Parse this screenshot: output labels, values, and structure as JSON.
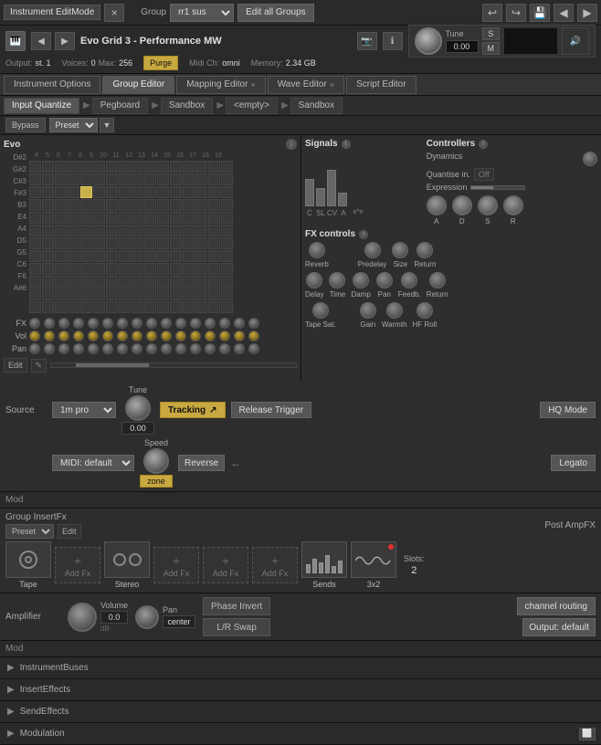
{
  "app": {
    "title": "Instrument EditMode",
    "close_label": "×"
  },
  "top_bar": {
    "mode_label": "Group",
    "group_select": "rr1 sus",
    "edit_btn": "Edit all Groups",
    "undo_icon": "↩",
    "redo_icon": "↪",
    "save_icon": "💾",
    "arrow_left": "◀",
    "arrow_right": "▶"
  },
  "instrument": {
    "name": "Evo Grid 3 - Performance MW",
    "output_label": "Output:",
    "output_val": "st. 1",
    "voices_label": "Voices:",
    "voices_val": "0",
    "max_label": "Max:",
    "max_val": "256",
    "purge_btn": "Purge",
    "midi_label": "Midi Ch:",
    "midi_val": "omni",
    "memory_label": "Memory:",
    "memory_val": "2.34 GB"
  },
  "tabs": {
    "instrument_options": "Instrument Options",
    "group_editor": "Group Editor",
    "mapping_editor": "Mapping Editor",
    "wave_editor": "Wave Editor",
    "script_editor": "Script Editor"
  },
  "sub_tabs": {
    "input_quantize": "Input Quantize",
    "pegboard": "Pegboard",
    "sandbox1": "Sandbox",
    "empty": "<empty>",
    "sandbox2": "Sandbox"
  },
  "evo": {
    "title": "Evo",
    "info": "ℹ",
    "note_labels": [
      "D#2",
      "G#2",
      "C#3",
      "F#3",
      "B3",
      "E4",
      "A4",
      "D5",
      "G5",
      "C6",
      "F6",
      "A#6",
      "FX",
      "Vol",
      "Pan"
    ],
    "col_nums": [
      "4",
      "5",
      "6",
      "7",
      "8",
      "9",
      "10",
      "11",
      "12",
      "13",
      "14",
      "15",
      "16",
      "17",
      "18",
      "19"
    ],
    "active_cell": {
      "row": 2,
      "col": 4
    }
  },
  "signals": {
    "title": "Signals",
    "labels": [
      "C",
      "SL",
      "CV",
      "A",
      "x^n"
    ],
    "dynamics": "Dynamics",
    "quantise": "Quantise in.",
    "off_label": "Off",
    "expression": "Expression"
  },
  "controllers": {
    "title": "Controllers",
    "adsr_labels": [
      "A",
      "D",
      "S",
      "R"
    ]
  },
  "fx_controls": {
    "title": "FX controls",
    "reverb": "Reverb",
    "predelay": "Predelay",
    "size": "Size",
    "return": "Return",
    "delay": "Delay",
    "time": "Time",
    "damp": "Damp",
    "pan": "Pan",
    "feedb": "Feedb.",
    "return2": "Return",
    "tape_sat": "Tape Sat.",
    "gain": "Gain",
    "warmth": "Warmth",
    "hf_roll": "HF Roll"
  },
  "source": {
    "label": "Source",
    "engine": "1m pro",
    "tune_label": "Tune",
    "tune_val": "0.00",
    "tracking_label": "Tracking",
    "release_trigger": "Release Trigger",
    "speed_label": "Speed",
    "speed_val": "zone",
    "midi_default": "MIDI: default",
    "reverse": "Reverse",
    "hq_mode": "HQ Mode",
    "legato": "Legato"
  },
  "mod": {
    "label": "Mod"
  },
  "group_fx": {
    "label": "Group InsertFx",
    "post_amp": "Post AmpFX",
    "preset_label": "Preset",
    "edit_label": "Edit",
    "tape_label": "Tape",
    "add_fx": "Add Fx",
    "stereo_label": "Stereo",
    "sends_label": "Sends",
    "slots_label": "Slots:",
    "slots_val": "2",
    "x3x2_label": "3x2"
  },
  "amplifier": {
    "label": "Amplifier",
    "volume_label": "Volume",
    "volume_val": "0.0",
    "volume_unit": "dB",
    "pan_label": "Pan",
    "pan_val": "center",
    "phase_invert": "Phase Invert",
    "lr_swap": "L/R Swap",
    "channel_routing": "channel routing",
    "output_label": "Output: default"
  },
  "collapsibles": {
    "instrument_buses": "InstrumentBuses",
    "insert_effects": "InsertEffects",
    "send_effects": "SendEffects",
    "modulation": "Modulation"
  },
  "tune_header": {
    "label": "Tune",
    "val": "0.00",
    "s_btn": "S",
    "m_btn": "M"
  }
}
